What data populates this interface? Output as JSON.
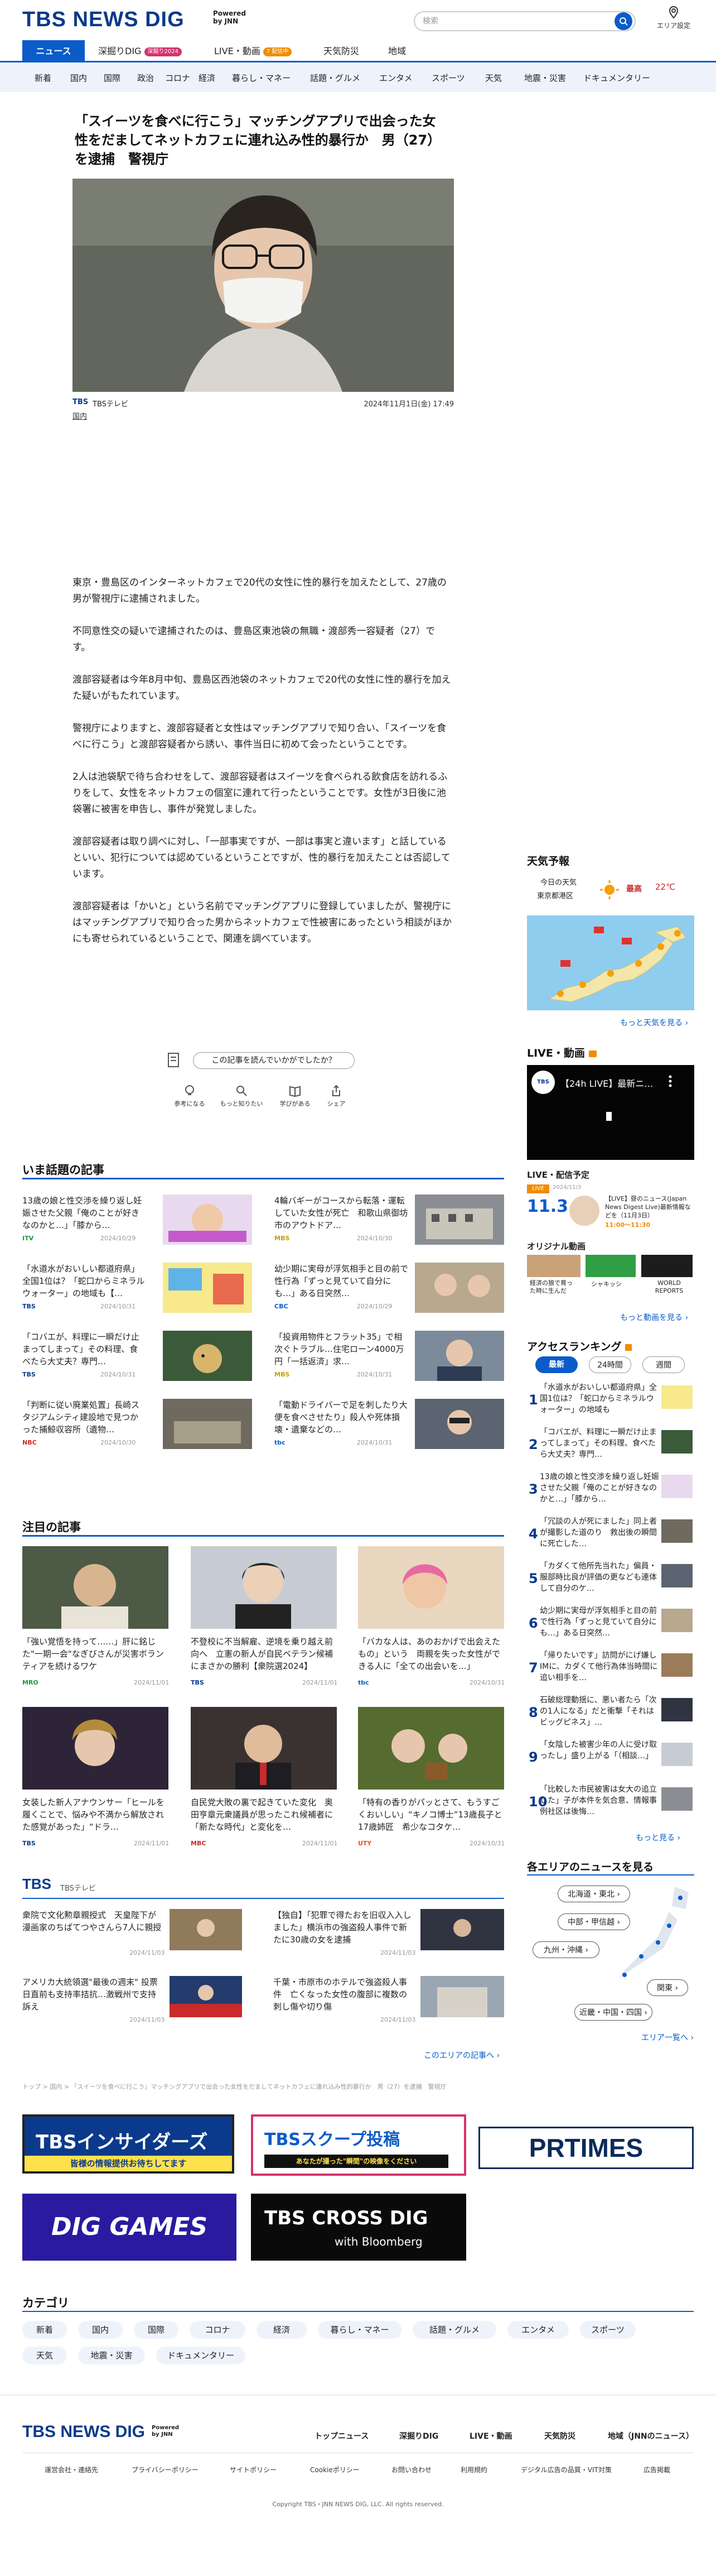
{
  "header": {
    "logo": "TBS NEWS DIG",
    "powered": "Powered by JNN",
    "search_placeholder": "検索",
    "area_label": "エリア設定"
  },
  "nav_primary": [
    {
      "label": "ニュース",
      "active": true
    },
    {
      "label": "深掘りDIG",
      "badge": "深掘り2024"
    },
    {
      "label": "LIVE・動画",
      "badge": "7 配信中"
    },
    {
      "label": "天気防災"
    },
    {
      "label": "地域"
    }
  ],
  "nav_secondary": [
    "新着",
    "国内",
    "国際",
    "政治",
    "コロナ",
    "経済",
    "暮らし・マネー",
    "話題・グルメ",
    "エンタメ",
    "スポーツ",
    "天気",
    "地震・災害",
    "ドキュメンタリー"
  ],
  "article": {
    "title": "「スイーツを食べに行こう」マッチングアプリで出会った女性をだましてネットカフェに連れ込み性的暴行か　男（27）を逮捕　警視庁",
    "source": "TBSテレビ",
    "date": "2024年11月1日(金) 17:49",
    "category": "国内",
    "paragraphs": [
      "東京・豊島区のインターネットカフェで20代の女性に性的暴行を加えたとして、27歳の男が警視庁に逮捕されました。",
      "不同意性交の疑いで逮捕されたのは、豊島区東池袋の無職・渡部秀一容疑者（27）です。",
      "渡部容疑者は今年8月中旬、豊島区西池袋のネットカフェで20代の女性に性的暴行を加えた疑いがもたれています。",
      "警視庁によりますと、渡部容疑者と女性はマッチングアプリで知り合い、「スイーツを食べに行こう」と渡部容疑者から誘い、事件当日に初めて会ったということです。",
      "2人は池袋駅で待ち合わせをして、渡部容疑者はスイーツを食べられる飲食店を訪れるふりをして、女性をネットカフェの個室に連れて行ったということです。女性が3日後に池袋署に被害を申告し、事件が発覚しました。",
      "渡部容疑者は取り調べに対し、「一部事実ですが、一部は事実と違います」と話しているといい、犯行については認めているということですが、性的暴行を加えたことは否認しています。",
      "渡部容疑者は「かいと」という名前でマッチングアプリに登録していましたが、警視庁にはマッチングアプリで知り合った男からネットカフェで性被害にあったという相談がほかにも寄せられているということで、関連を調べています。"
    ]
  },
  "feedback": {
    "question": "この記事を読んでいかがでしたか？",
    "buttons": [
      "参考になる",
      "もっと知りたい",
      "学びがある",
      "シェア"
    ]
  },
  "trending": {
    "heading": "いま話題の記事",
    "items": [
      {
        "title": "13歳の娘と性交渉を繰り返し妊娠させた父親「俺のことが好きなのかと…」「膝から…",
        "src": "ITV",
        "date": "2024/10/29"
      },
      {
        "title": "4輪バギーがコースから転落・運転していた女性が死亡　和歌山県御坊市のアウトドア…",
        "src": "MBS",
        "date": "2024/10/30"
      },
      {
        "title": "「水道水がおいしい都道府県」全国1位は？「蛇口からミネラルウォーター」の地域も【…",
        "src": "TBS",
        "date": "2024/10/31"
      },
      {
        "title": "幼少期に実母が浮気相手と目の前で性行為「ずっと見ていて自分にも…」ある日突然…",
        "src": "CBC",
        "date": "2024/10/29"
      },
      {
        "title": "「コバエが、料理に一瞬だけ止まってしまって」その料理、食べたら大丈夫？専門…",
        "src": "TBS",
        "date": "2024/10/31"
      },
      {
        "title": "「投資用物件とフラット35」で相次ぐトラブル…住宅ローン4000万円「一括返済」求…",
        "src": "MBS",
        "date": "2024/10/31"
      },
      {
        "title": "「判断に従い廃業処置」長崎スタジアムシティ建設地で見つかった捕鯨収容所（遺物…",
        "src": "NBC",
        "date": "2024/10/30"
      },
      {
        "title": "「電動ドライバーで足を刺したり大便を食べさせたり」殺人や死体損壊・遺棄などの…",
        "src": "tbc",
        "date": "2024/10/31"
      }
    ]
  },
  "featured": {
    "heading": "注目の記事",
    "items": [
      {
        "title": "「強い覚悟を持って……」肝に銘じた\"一期一会\"なぎびさんが災害ボランティアを続けるワケ",
        "src": "MRO",
        "date": "2024/11/01"
      },
      {
        "title": "不登校に不当解雇、逆境を乗り越え前向へ　立憲の新人が自民ベテラン候補にまさかの勝利【衆院選2024】",
        "src": "TBS",
        "date": "2024/11/01"
      },
      {
        "title": "「バカな人は、あのおかげで出会えたもの」という　両親を失った女性ができる人に「全ての出会いを…」",
        "src": "tbc",
        "date": "2024/10/31"
      },
      {
        "title": "女装した新人アナウンサー「ヒールを履くことで、悩みや不満から解放された感覚があった」“ドラ…",
        "src": "TBS",
        "date": "2024/11/01"
      },
      {
        "title": "自民党大敗の裏で起きていた変化　奥田亨章元衆議員が思ったこれ候補者に「新たな時代」と変化を…",
        "src": "MBC",
        "date": "2024/11/01"
      },
      {
        "title": "「特有の香りがパッとさて、もうすごくおいしい」“キノコ博士”13歳長子と17歳姉匠　希少なコタケ…",
        "src": "UTY",
        "date": "2024/10/31"
      }
    ]
  },
  "tbs_block": {
    "logo": "TBS",
    "sub": "TBSテレビ",
    "items": [
      {
        "title": "衆院で文化勲章親授式　天皇陛下が漫画家のちばてつやさんら7人に親授",
        "date": "2024/11/03"
      },
      {
        "title": "【独自】「犯罪で得たおを旧収入入しました」横浜市の強盗殺人事件で新たに30歳の女を逮捕",
        "date": "2024/11/03"
      },
      {
        "title": "アメリカ大統領選\"最後の週末\" 投票日直前も支持率拮抗…激戦州で支持訴え",
        "date": "2024/11/03"
      },
      {
        "title": "千葉・市原市のホテルで強盗殺人事件　亡くなった女性の腹部に複数の刺し傷や切り傷",
        "date": "2024/11/03"
      }
    ],
    "more": "このエリアの記事へ"
  },
  "breadcrumb": "トップ > 国内 > 「スイーツを食べに行こう」マッチングアプリで出会った女性をだましてネットカフェに連れ込み性的暴行か　男（27）を逮捕　警視庁",
  "banners": [
    {
      "label": "TBSインサイダーズ",
      "sub": "皆様の情報提供お待ちしてます"
    },
    {
      "label": "TBSスクープ投稿",
      "sub": "あなたが撮った\"瞬間\"の映像をください"
    },
    {
      "label": "PRTIMES"
    },
    {
      "label": "DIG GAMES"
    },
    {
      "label": "TBS CROSS DIG",
      "sub": "with Bloomberg"
    }
  ],
  "categories": {
    "heading": "カテゴリ",
    "items": [
      "新着",
      "国内",
      "国際",
      "コロナ",
      "経済",
      "暮らし・マネー",
      "話題・グルメ",
      "エンタメ",
      "スポーツ",
      "天気",
      "地震・災害",
      "ドキュメンタリー"
    ]
  },
  "footer": {
    "logo": "TBS NEWS DIG",
    "powered": "Powered by JNN",
    "links": [
      "トップニュース",
      "深掘りDIG",
      "LIVE・動画",
      "天気防災",
      "地域（JNNのニュース）"
    ],
    "sublinks": [
      "運営会社・連絡先",
      "プライバシーポリシー",
      "サイトポリシー",
      "Cookieポリシー",
      "お問い合わせ",
      "利用規約",
      "デジタル広告の品質・VIT対策",
      "広告掲載"
    ],
    "copyright": "Copyright TBS・JNN NEWS DIG, LLC. All rights reserved."
  },
  "sidebar": {
    "weather": {
      "heading": "天気予報",
      "place": "今日の天気",
      "city": "東京都港区",
      "temp_label": "最高",
      "temp": "22℃",
      "more": "もっと天気を見る"
    },
    "live": {
      "heading": "LIVE・動画",
      "badge": "LIVE",
      "video_title": "【24h LIVE】最新ニ…",
      "schedule_heading": "LIVE・配信予定",
      "date_label": "11.3",
      "date_label2": "2024/11/3",
      "sched_title": "【LIVE】昼のニュース(Japan News Digest Live)最新情報などを（11月3日）",
      "sched_time": "11:00～11:30"
    },
    "originals": {
      "heading": "オリジナル動画",
      "items": [
        "経済の狼で育っ た時に生んだ",
        "シャキッシ",
        "WORLD REPORTS"
      ],
      "more": "もっと動画を見る"
    },
    "ranking": {
      "heading": "アクセスランキング",
      "tabs": [
        "最新",
        "24時間",
        "週間"
      ],
      "items": [
        "「水道水がおいしい都道府県」全国1位は？「蛇口からミネラルウォーター」の地域も",
        "「コバエが、料理に一瞬だけ止まってしまって」その料理、食べたら大丈夫？専門…",
        "13歳の娘と性交渉を繰り返し妊娠させた父親「俺のことが好きなのかと…」「膝から…",
        "「冗談の人が死にました」同上者が撮影した道のり　救出後の瞬間に死亡した…",
        "「カダくて他所先当れた」偏員・服部時比良が評価の更なども連体して自分のケ…",
        "幼少期に実母が浮気相手と目の前で性行為「ずっと見ていて自分にも…」ある日突然…",
        "「帰りたいです」訪問がにげ嫌しIMに、カダくて他行為体当時間に追い相手を…",
        "石破総理動揺に、悪い者たら「次の1人になる」だと衝撃「それはビッグピネス」…",
        "「女陰した被害少年の人に受け取ったし」盛り上がる「（相談…」",
        "「比較した市民被害は女大の追立した」子が本件を気合意、情報事例社区は後悔…"
      ],
      "more": "もっと見る"
    },
    "regions": {
      "heading": "各エリアのニュースを見る",
      "buttons": [
        "北海道・東北",
        "中部・甲信越",
        "九州・沖縄",
        "関東",
        "近畿・中国・四国"
      ],
      "more": "エリア一覧へ"
    }
  }
}
